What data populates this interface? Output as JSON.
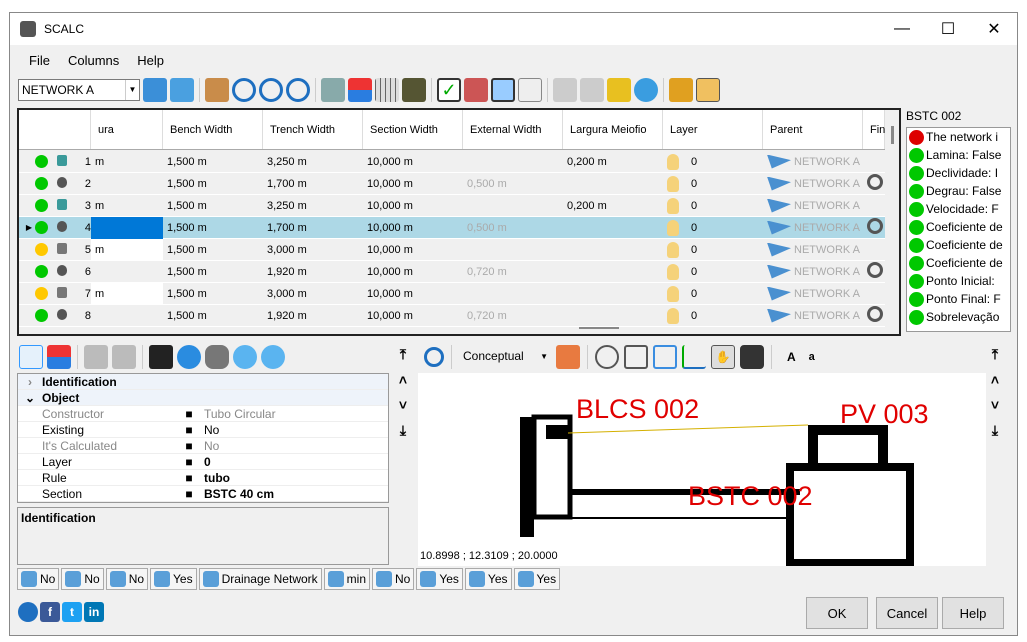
{
  "window": {
    "title": "SCALC",
    "controls": [
      "—",
      "☐",
      "✕"
    ]
  },
  "menu": [
    "File",
    "Columns",
    "Help"
  ],
  "toolbar": {
    "network_select": "NETWORK A"
  },
  "grid": {
    "columns": [
      "ura",
      "Bench Width",
      "Trench Width",
      "Section Width",
      "External Width",
      "Largura Meiofio",
      "Layer",
      "Parent",
      "Fin"
    ],
    "rows": [
      {
        "n": "1",
        "status": "green",
        "type": "pv",
        "ura": "m",
        "bench": "1,500 m",
        "trench": "3,250 m",
        "section": "10,000 m",
        "ext": "",
        "meio": "0,200 m",
        "layer": "0",
        "parent": "NETWORK A",
        "target": false
      },
      {
        "n": "2",
        "status": "green",
        "type": "pipe",
        "ura": "",
        "bench": "1,500 m",
        "trench": "1,700 m",
        "section": "10,000 m",
        "ext": "0,500 m",
        "meio": "",
        "layer": "0",
        "parent": "NETWORK A",
        "target": true
      },
      {
        "n": "3",
        "status": "green",
        "type": "pv",
        "ura": "m",
        "bench": "1,500 m",
        "trench": "3,250 m",
        "section": "10,000 m",
        "ext": "",
        "meio": "0,200 m",
        "layer": "0",
        "parent": "NETWORK A",
        "target": false
      },
      {
        "n": "4",
        "status": "green",
        "type": "pipe",
        "ura": "",
        "bench": "1,500 m",
        "trench": "1,700 m",
        "section": "10,000 m",
        "ext": "0,500 m",
        "meio": "",
        "layer": "0",
        "parent": "NETWORK A",
        "target": true
      },
      {
        "n": "5",
        "status": "yellow",
        "type": "node",
        "ura": "m",
        "bench": "1,500 m",
        "trench": "3,000 m",
        "section": "10,000 m",
        "ext": "",
        "meio": "",
        "layer": "0",
        "parent": "NETWORK A",
        "target": false
      },
      {
        "n": "6",
        "status": "green",
        "type": "pipe",
        "ura": "",
        "bench": "1,500 m",
        "trench": "1,920 m",
        "section": "10,000 m",
        "ext": "0,720 m",
        "meio": "",
        "layer": "0",
        "parent": "NETWORK A",
        "target": true
      },
      {
        "n": "7",
        "status": "yellow",
        "type": "node",
        "ura": "m",
        "bench": "1,500 m",
        "trench": "3,000 m",
        "section": "10,000 m",
        "ext": "",
        "meio": "",
        "layer": "0",
        "parent": "NETWORK A",
        "target": false
      },
      {
        "n": "8",
        "status": "green",
        "type": "pipe",
        "ura": "",
        "bench": "1,500 m",
        "trench": "1,920 m",
        "section": "10,000 m",
        "ext": "0,720 m",
        "meio": "",
        "layer": "0",
        "parent": "NETWORK A",
        "target": true
      }
    ],
    "selected_row": "4"
  },
  "checks": {
    "title": "BSTC 002",
    "items": [
      {
        "status": "red",
        "text": "The network i"
      },
      {
        "status": "green",
        "text": "Lamina: False"
      },
      {
        "status": "green",
        "text": "Declividade: I"
      },
      {
        "status": "green",
        "text": "Degrau: False"
      },
      {
        "status": "green",
        "text": "Velocidade: F"
      },
      {
        "status": "green",
        "text": "Coeficiente de"
      },
      {
        "status": "green",
        "text": "Coeficiente de"
      },
      {
        "status": "green",
        "text": "Coeficiente de"
      },
      {
        "status": "green",
        "text": "Ponto Inicial:"
      },
      {
        "status": "green",
        "text": "Ponto Final: F"
      },
      {
        "status": "green",
        "text": "Sobrelevação"
      }
    ]
  },
  "props": {
    "groups": {
      "identification": "Identification",
      "object": "Object"
    },
    "rows": [
      {
        "name": "Constructor",
        "value": "Tubo Circular",
        "dim": true,
        "bold": false,
        "icon": "gear-icon"
      },
      {
        "name": "Existing",
        "value": "No",
        "dim": false,
        "bold": false,
        "icon": "checkbox-icon"
      },
      {
        "name": "It's Calculated",
        "value": "No",
        "dim": true,
        "bold": false,
        "icon": "checkbox-icon"
      },
      {
        "name": "Layer",
        "value": "0",
        "dim": false,
        "bold": true,
        "icon": "bulb-icon"
      },
      {
        "name": "Rule",
        "value": "tubo",
        "dim": false,
        "bold": true,
        "icon": "check-icon"
      },
      {
        "name": "Section",
        "value": "BSTC 40 cm",
        "dim": false,
        "bold": true,
        "icon": "section-icon"
      }
    ],
    "description": "Identification"
  },
  "view": {
    "style": "Conceptual",
    "text_a1": "A",
    "text_a2": "a",
    "labels": [
      "BLCS 002",
      "PV 003",
      "BSTC 002"
    ],
    "coords": "10.8998 ; 12.3109 ; 20.0000"
  },
  "status_bar": [
    {
      "icon": "network-a-icon",
      "text": "No"
    },
    {
      "icon": "network-b-icon",
      "text": "No"
    },
    {
      "icon": "flag-icon",
      "text": "No"
    },
    {
      "icon": "machine-icon",
      "text": "Yes"
    },
    {
      "icon": "drainage-icon",
      "text": "Drainage Network"
    },
    {
      "icon": "table-icon",
      "text": "min"
    },
    {
      "icon": "zoom-icon",
      "text": "No"
    },
    {
      "icon": "pv-icon",
      "text": "Yes"
    },
    {
      "icon": "pipe-icon",
      "text": "Yes"
    },
    {
      "icon": "bend-icon",
      "text": "Yes"
    }
  ],
  "buttons": {
    "ok": "OK",
    "cancel": "Cancel",
    "help": "Help"
  },
  "social": {
    "facebook": "f",
    "linkedin": "in"
  },
  "colors": {
    "green": "#00c800",
    "yellow": "#ffc800",
    "red": "#dd0000",
    "selected": "#add8e6",
    "label_red": "#e00000"
  }
}
